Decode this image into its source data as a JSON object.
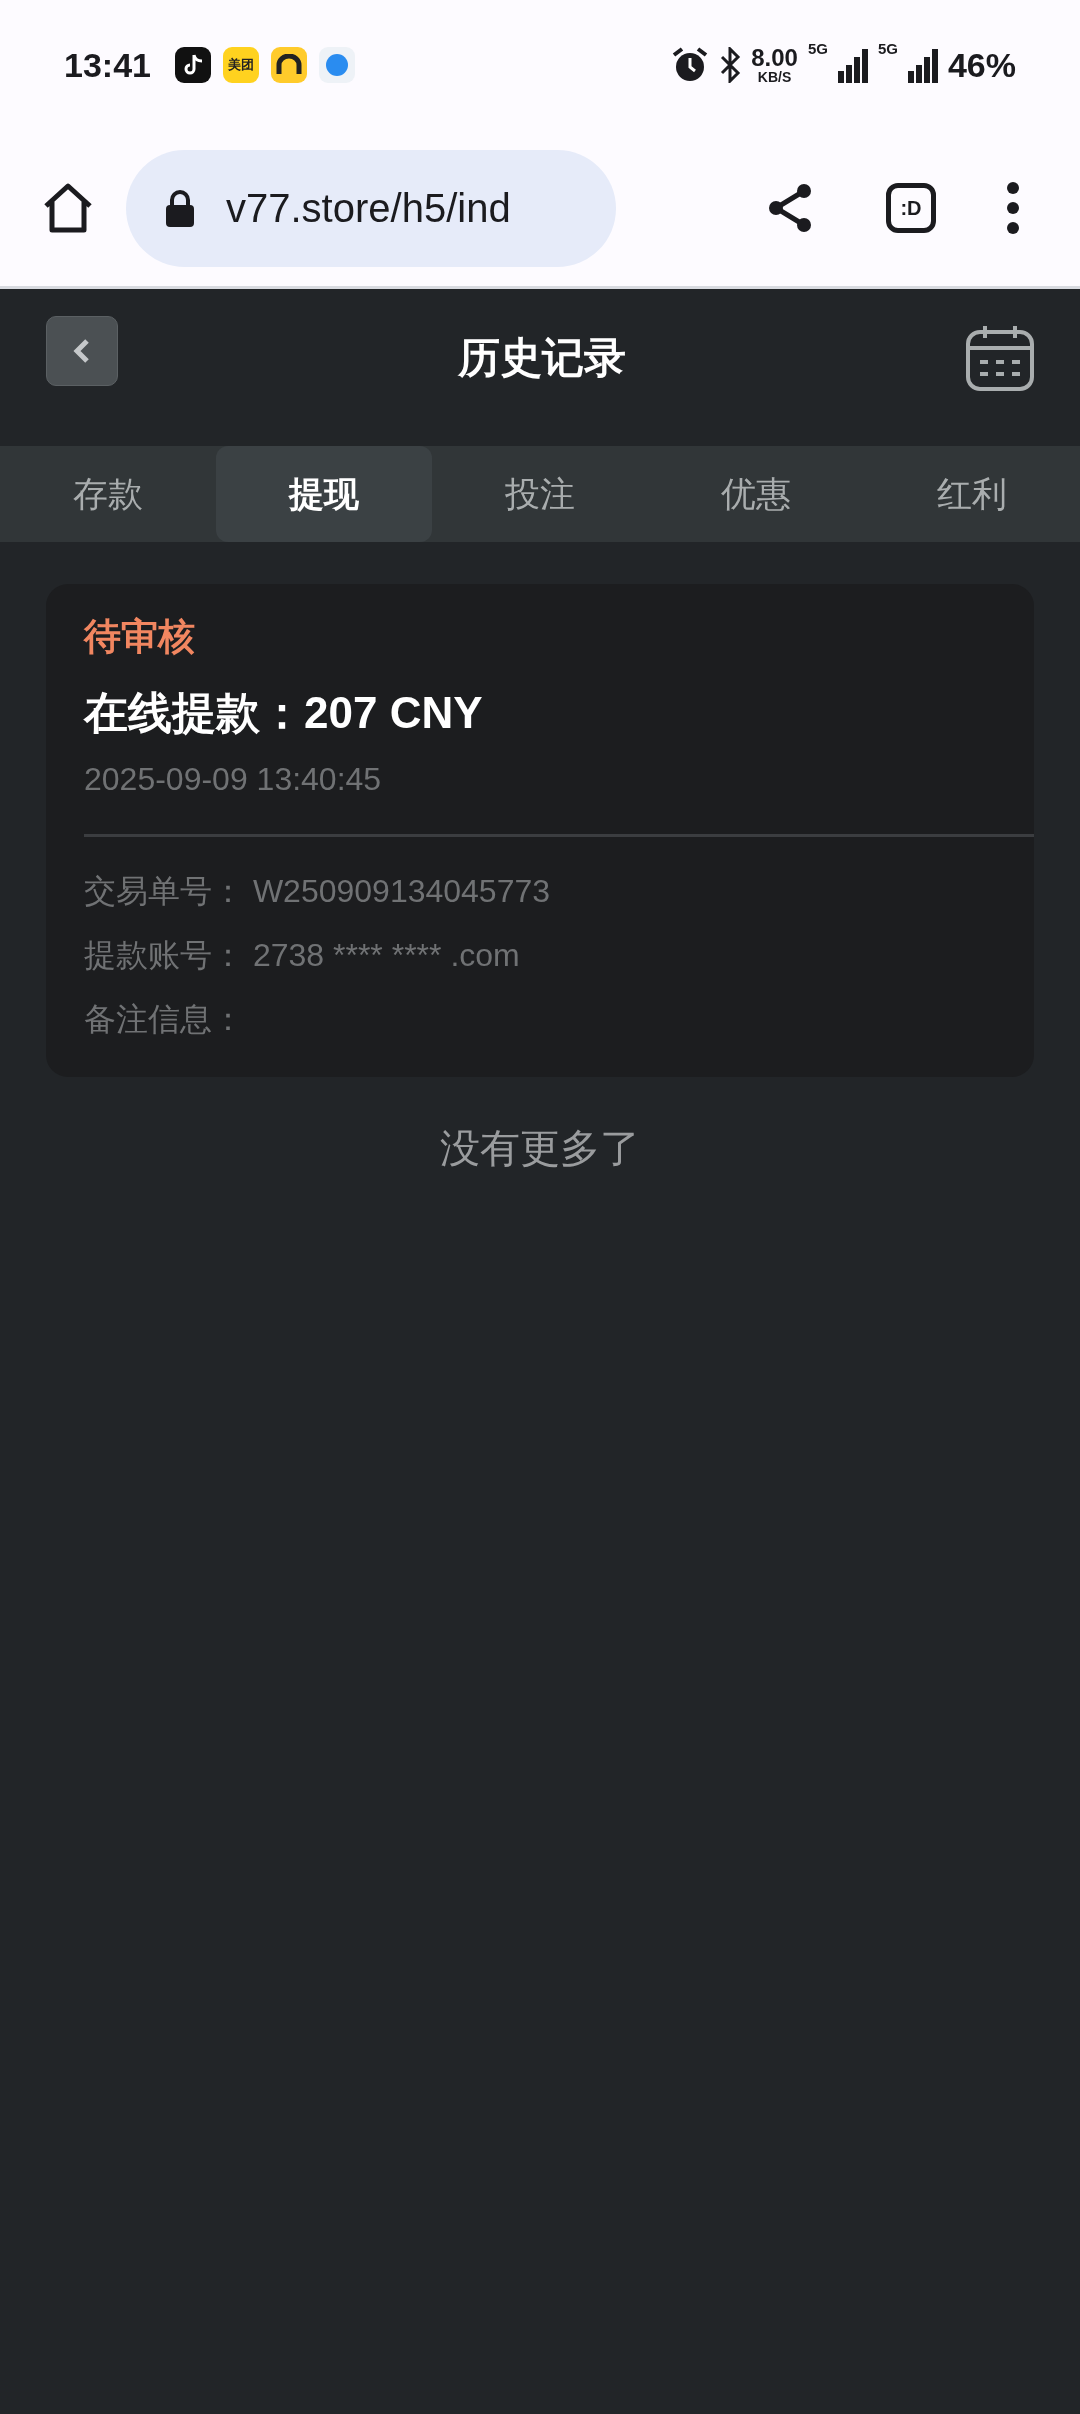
{
  "status_bar": {
    "time": "13:41",
    "app_badge": "美团",
    "speed": "8.00",
    "speed_unit": "KB/S",
    "network_1": "5G",
    "network_2": "5G",
    "battery": "46%"
  },
  "browser": {
    "url": "v77.store/h5/ind",
    "tab_badge": ":D"
  },
  "header": {
    "title": "历史记录"
  },
  "tabs": [
    {
      "label": "存款",
      "selected": false
    },
    {
      "label": "提现",
      "selected": true
    },
    {
      "label": "投注",
      "selected": false
    },
    {
      "label": "优惠",
      "selected": false
    },
    {
      "label": "红利",
      "selected": false
    }
  ],
  "records": [
    {
      "status": "待审核",
      "title": "在线提款：207 CNY",
      "time": "2025-09-09 13:40:45",
      "details": [
        {
          "label": "交易单号：",
          "value": "W250909134045773"
        },
        {
          "label": "提款账号：",
          "value": "2738 **** **** .com"
        },
        {
          "label": "备注信息："
        }
      ]
    }
  ],
  "footer": "没有更多了"
}
